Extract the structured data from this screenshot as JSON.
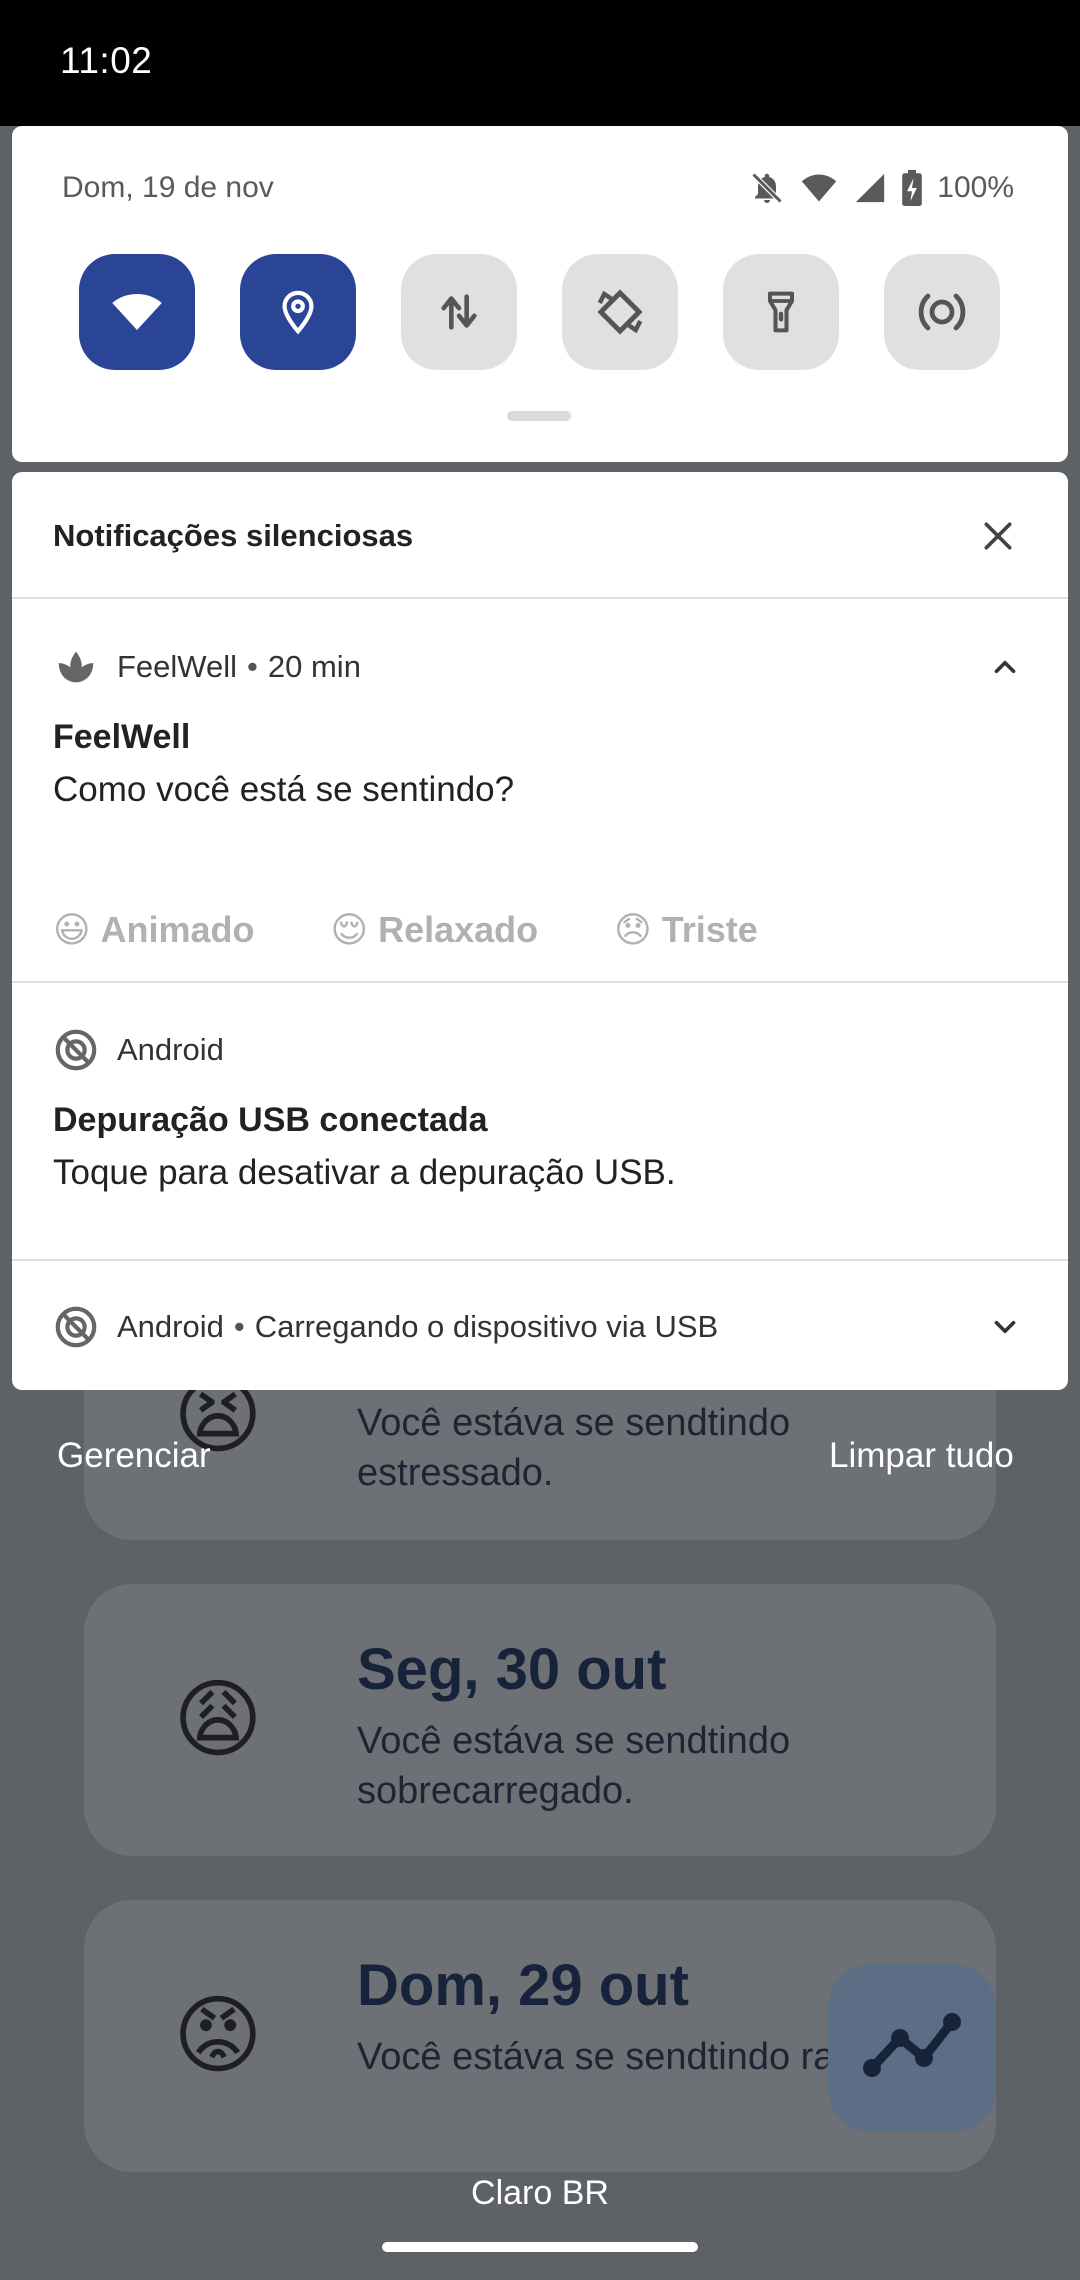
{
  "status_bar": {
    "time": "11:02"
  },
  "quick_settings": {
    "date": "Dom, 19 de nov",
    "battery": "100%",
    "tiles": [
      {
        "name": "wifi",
        "icon": "wifi-icon",
        "active": true
      },
      {
        "name": "location",
        "icon": "location-icon",
        "active": true
      },
      {
        "name": "mobile-data",
        "icon": "data-arrows-icon",
        "active": false
      },
      {
        "name": "auto-rotate",
        "icon": "rotate-icon",
        "active": false
      },
      {
        "name": "flashlight",
        "icon": "flashlight-icon",
        "active": false
      },
      {
        "name": "hotspot",
        "icon": "hotspot-icon",
        "active": false
      }
    ]
  },
  "shade": {
    "section_title": "Notificações silenciosas",
    "notifications": [
      {
        "app": "FeelWell",
        "time": "20 min",
        "title": "FeelWell",
        "text": "Como você está se sentindo?",
        "actions": [
          {
            "emoji": "😃",
            "label": "Animado"
          },
          {
            "emoji": "😌",
            "label": "Relaxado"
          },
          {
            "emoji": "😞",
            "label": "Triste"
          }
        ]
      },
      {
        "app": "Android",
        "title": "Depuração USB conectada",
        "text": "Toque para desativar a depuração USB."
      },
      {
        "app": "Android",
        "text": "Carregando o dispositivo via USB"
      }
    ],
    "manage_label": "Gerenciar",
    "clear_all_label": "Limpar tudo"
  },
  "background_app": {
    "entries": [
      {
        "date": "",
        "emoji": "😫",
        "text": "Você estáva se sendtindo estressado."
      },
      {
        "date": "Seg, 30 out",
        "emoji": "😩",
        "text": "Você estáva se sendtindo sobrecarregado."
      },
      {
        "date": "Dom, 29 out",
        "emoji": "😡",
        "text": "Você estáva se sendtindo raiva."
      }
    ]
  },
  "carrier": "Claro BR",
  "colors": {
    "tile_active": "#2a4596",
    "tile_inactive": "#e0e0e0",
    "scrim": "#5e6166"
  }
}
